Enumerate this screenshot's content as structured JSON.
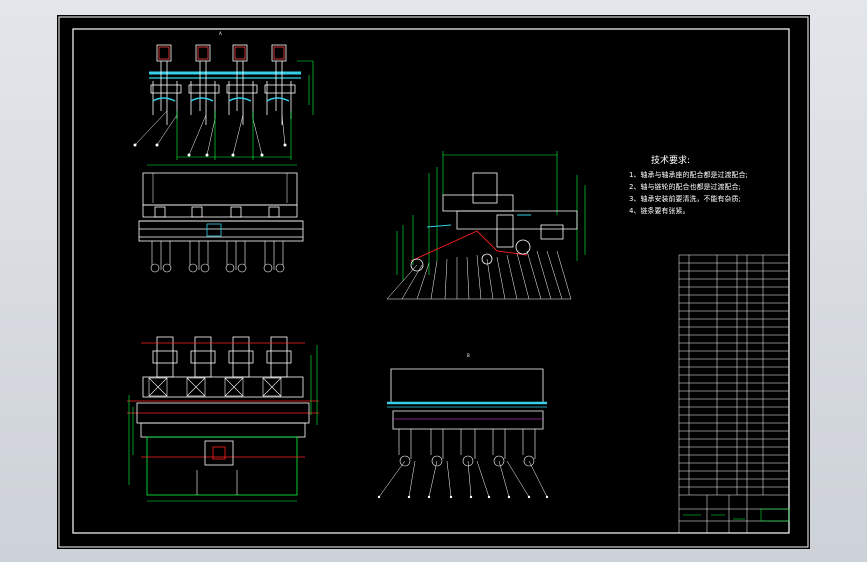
{
  "window": {
    "title": "CAD drawing viewer"
  },
  "drawing": {
    "background": "#000000",
    "colors": {
      "line": "#ffffff",
      "dimension": "#00ff3c",
      "cyan": "#35d0e8",
      "red": "#ff2020",
      "magenta": "#ff40ff"
    }
  },
  "tech_requirements": {
    "title": "技术要求:",
    "items": [
      "1、轴承与轴承座的配合都是过渡配合;",
      "2、轴与链轮的配合也都是过渡配合;",
      "3、轴承安装前要清洗，不能有杂质;",
      "4、链条要有张紧。"
    ]
  },
  "icons": [
    "title-block-table",
    "view-label"
  ]
}
